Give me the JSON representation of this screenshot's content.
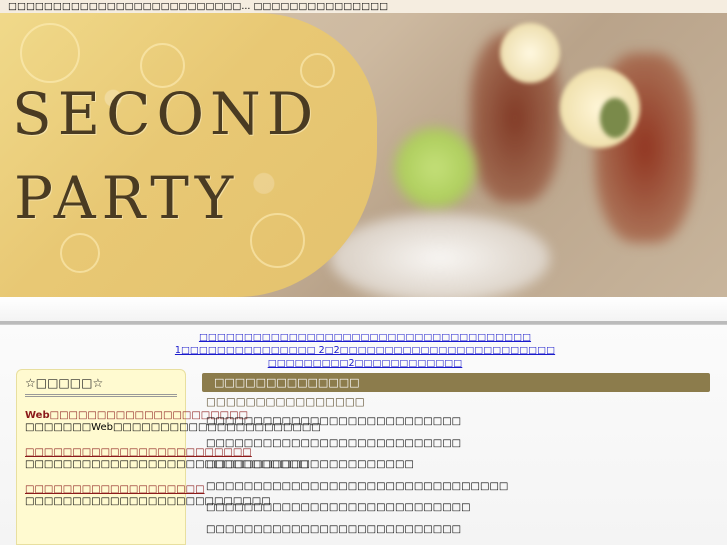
{
  "topbar": {
    "text": "□□□□□□□□□□□□□□□□□□□□□□□□□□... □□□□□□□□□□□□□□□"
  },
  "banner": {
    "logo_line1": "SECOND",
    "logo_line2": "PARTY"
  },
  "notice": {
    "text1": "□□□□□□□□□□□□□□□□□□□□□□□□□□□□□□□□□□□□□ 1□□□□□□□□□□□□□□□ 2□2□□□□□□□□□□□□□□□□□□□□□□□□",
    "text2": "□□□□□□□□□2□□□□□□□□□□□□"
  },
  "sidebar": {
    "title": "☆□□□□□☆",
    "items": [
      {
        "title": "Web□□□□□□□□□□□□□□□□□□□□□",
        "desc": "□□□□□□□Web□□□□□□□□□□□□□□□□□□□□□□",
        "link": false
      },
      {
        "title": "□□□□□□□□□□□□□□□□□□□□□□□□",
        "desc": "□□□□□□□□□□□□□□□□□□□□□□□□□□□□□□",
        "link": true
      },
      {
        "title": "□□□□□□□□□□□□□□□□□□□",
        "desc": "□□□□□□□□□□□□□□□□□□□□□□□□□□",
        "link": true
      }
    ]
  },
  "main": {
    "heading": "□□□□□□□□□□□□□□",
    "subheading": "□□□□□□□□□□□□□□□□",
    "list": [
      "□□□□□□□□□□□□□□□□□□□□□□□□□□□",
      "□□□□□□□□□□□□□□□□□□□□□□□□□□□",
      "□□□□□□□□□□□□□□□□□□□□□□",
      "□□□□□□□□□□□□□□□□□□□□□□□□□□□□□□□□",
      "□□□□□□□□□□□□□□□□□□□□□□□□□□□□",
      "□□□□□□□□□□□□□□□□□□□□□□□□□□□",
      "□□□□□□□□□□□□□□□□"
    ]
  },
  "colors": {
    "header_bar": "#8c7c4c",
    "sidebar_bg": "#fffad0",
    "sidebar_link": "#8b1a1a",
    "notice_link": "#1a1acc"
  }
}
